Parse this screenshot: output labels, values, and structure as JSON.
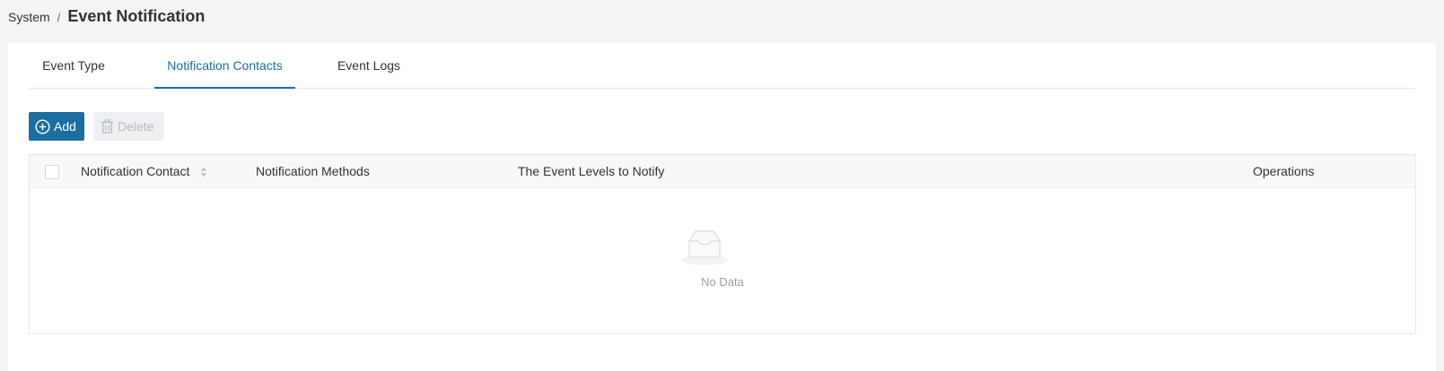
{
  "breadcrumb": {
    "parent": "System",
    "separator": "/",
    "title": "Event Notification"
  },
  "tabs": [
    {
      "label": "Event Type",
      "active": false
    },
    {
      "label": "Notification Contacts",
      "active": true
    },
    {
      "label": "Event Logs",
      "active": false
    }
  ],
  "toolbar": {
    "add_label": "Add",
    "add_icon": "plus-circle-icon",
    "delete_label": "Delete",
    "delete_icon": "trash-icon",
    "delete_disabled": true
  },
  "table": {
    "columns": [
      {
        "label": "Notification Contact",
        "sortable": true
      },
      {
        "label": "Notification Methods",
        "sortable": false
      },
      {
        "label": "The Event Levels to Notify",
        "sortable": false
      },
      {
        "label": "Operations",
        "sortable": false
      }
    ],
    "rows": [],
    "empty_text": "No Data",
    "empty_icon": "empty-inbox-icon"
  },
  "colors": {
    "accent": "#1a6fa0",
    "page_bg": "#f3f4f6",
    "panel_bg": "#ffffff",
    "disabled_text": "#b8bcc2"
  }
}
